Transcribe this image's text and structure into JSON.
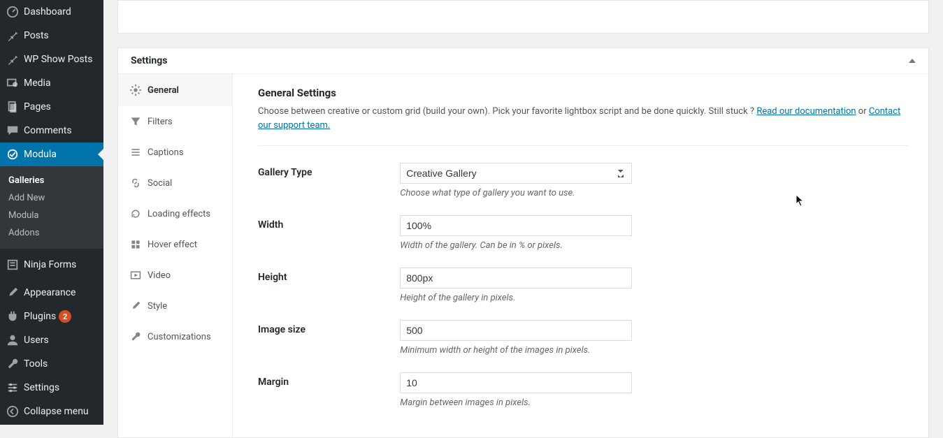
{
  "sidebar": {
    "items": [
      {
        "label": "Dashboard",
        "icon": "dashboard"
      },
      {
        "label": "Posts",
        "icon": "pin"
      },
      {
        "label": "WP Show Posts",
        "icon": "pin"
      },
      {
        "label": "Media",
        "icon": "media"
      },
      {
        "label": "Pages",
        "icon": "page"
      },
      {
        "label": "Comments",
        "icon": "comment"
      },
      {
        "label": "Modula",
        "icon": "modula",
        "active": true
      },
      {
        "label": "Ninja Forms",
        "icon": "form"
      },
      {
        "label": "Appearance",
        "icon": "brush"
      },
      {
        "label": "Plugins",
        "icon": "plugin",
        "badge": "2"
      },
      {
        "label": "Users",
        "icon": "user"
      },
      {
        "label": "Tools",
        "icon": "wrench"
      },
      {
        "label": "Settings",
        "icon": "sliders"
      },
      {
        "label": "Collapse menu",
        "icon": "collapse"
      }
    ],
    "submenu": [
      {
        "label": "Galleries",
        "current": true
      },
      {
        "label": "Add New"
      },
      {
        "label": "Modula"
      },
      {
        "label": "Addons"
      }
    ]
  },
  "panel": {
    "title": "Settings",
    "tabs": [
      {
        "label": "General",
        "icon": "gear",
        "active": true
      },
      {
        "label": "Filters",
        "icon": "filter"
      },
      {
        "label": "Captions",
        "icon": "list"
      },
      {
        "label": "Social",
        "icon": "link"
      },
      {
        "label": "Loading effects",
        "icon": "reload"
      },
      {
        "label": "Hover effect",
        "icon": "grid"
      },
      {
        "label": "Video",
        "icon": "play"
      },
      {
        "label": "Style",
        "icon": "brush"
      },
      {
        "label": "Customizations",
        "icon": "wrench"
      }
    ]
  },
  "content": {
    "heading": "General Settings",
    "intro_1": "Choose between creative or custom grid (build your own). Pick your favorite lightbox script and be done quickly. Still stuck ? ",
    "link_docs": "Read our documentation",
    "intro_or": " or ",
    "link_support": "Contact our support team.",
    "fields": {
      "gallery_type": {
        "label": "Gallery Type",
        "value": "Creative Gallery",
        "hint": "Choose what type of gallery you want to use."
      },
      "width": {
        "label": "Width",
        "value": "100%",
        "hint": "Width of the gallery. Can be in % or pixels."
      },
      "height": {
        "label": "Height",
        "value": "800px",
        "hint": "Height of the gallery in pixels."
      },
      "image_size": {
        "label": "Image size",
        "value": "500",
        "hint": "Minimum width or height of the images in pixels."
      },
      "margin": {
        "label": "Margin",
        "value": "10",
        "hint": "Margin between images in pixels."
      }
    }
  }
}
